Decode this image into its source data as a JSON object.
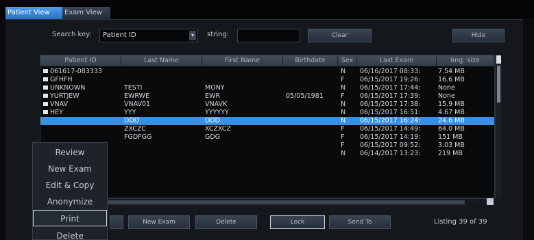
{
  "tabs": [
    {
      "label": "Patient View",
      "active": true
    },
    {
      "label": "Exam View",
      "active": false
    }
  ],
  "search": {
    "key_label": "Search key:",
    "key_value": "Patient ID",
    "string_label": "string:",
    "string_value": "",
    "clear_label": "Clear",
    "hide_label": "Hide"
  },
  "table": {
    "columns": [
      "Patient ID",
      "Last Name",
      "First Name",
      "Birthdate",
      "Sex",
      "Last Exam",
      "Img. size"
    ],
    "rows": [
      {
        "id": "061617-083333",
        "last": "",
        "first": "",
        "birth": "",
        "sex": "N",
        "exam": "06/16/2017 08:33:",
        "size": "7.54 MB",
        "selected": false
      },
      {
        "id": "GFHFH",
        "last": "",
        "first": "",
        "birth": "",
        "sex": "F",
        "exam": "06/15/2017 19:26:",
        "size": "16.6 MB",
        "selected": false
      },
      {
        "id": "UNKNOWN",
        "last": "TESTI",
        "first": "MONY",
        "birth": "",
        "sex": "N",
        "exam": "06/15/2017 17:44:",
        "size": "None",
        "selected": false
      },
      {
        "id": "YURTJEW",
        "last": "EWRWE",
        "first": "EWR",
        "birth": "05/05/1981",
        "sex": "F",
        "exam": "06/15/2017 17:39:",
        "size": "None",
        "selected": false
      },
      {
        "id": "VNAV",
        "last": "VNAV01",
        "first": "VNAVK",
        "birth": "",
        "sex": "N",
        "exam": "06/15/2017 17:38:",
        "size": "15.9 MB",
        "selected": false
      },
      {
        "id": "HEY",
        "last": "YYY",
        "first": "YYYYYY",
        "birth": "",
        "sex": "N",
        "exam": "06/15/2017 16:51:",
        "size": "4.67 MB",
        "selected": false
      },
      {
        "id": "",
        "last": "DDD",
        "first": "DDD",
        "birth": "",
        "sex": "N",
        "exam": "06/15/2017 16:24:",
        "size": "24.6 MB",
        "selected": true
      },
      {
        "id": "",
        "last": "ZXCZC",
        "first": "XCZXCZ",
        "birth": "",
        "sex": "F",
        "exam": "06/15/2017 14:49:",
        "size": "64.0 MB",
        "selected": false
      },
      {
        "id": "",
        "last": "FGDFGG",
        "first": "GDG",
        "birth": "",
        "sex": "F",
        "exam": "06/15/2017 14:19:",
        "size": "151 MB",
        "selected": false
      },
      {
        "id": "",
        "last": "",
        "first": "",
        "birth": "",
        "sex": "F",
        "exam": "06/15/2017 09:52:",
        "size": "3.03 MB",
        "selected": false
      },
      {
        "id": "",
        "last": "",
        "first": "",
        "birth": "",
        "sex": "N",
        "exam": "06/14/2017 13:23:",
        "size": "219 MB",
        "selected": false
      }
    ]
  },
  "actions": {
    "new_exam": "New Exam",
    "delete": "Delete",
    "lock": "Lock",
    "send_to": "Send To"
  },
  "listing": "Listing 39 of 39",
  "context_menu": [
    "Review",
    "New Exam",
    "Edit & Copy",
    "Anonymize",
    "Print",
    "Delete"
  ],
  "colors": {
    "selection": "#3a8fe0",
    "active_tab": "#3d87d8"
  }
}
